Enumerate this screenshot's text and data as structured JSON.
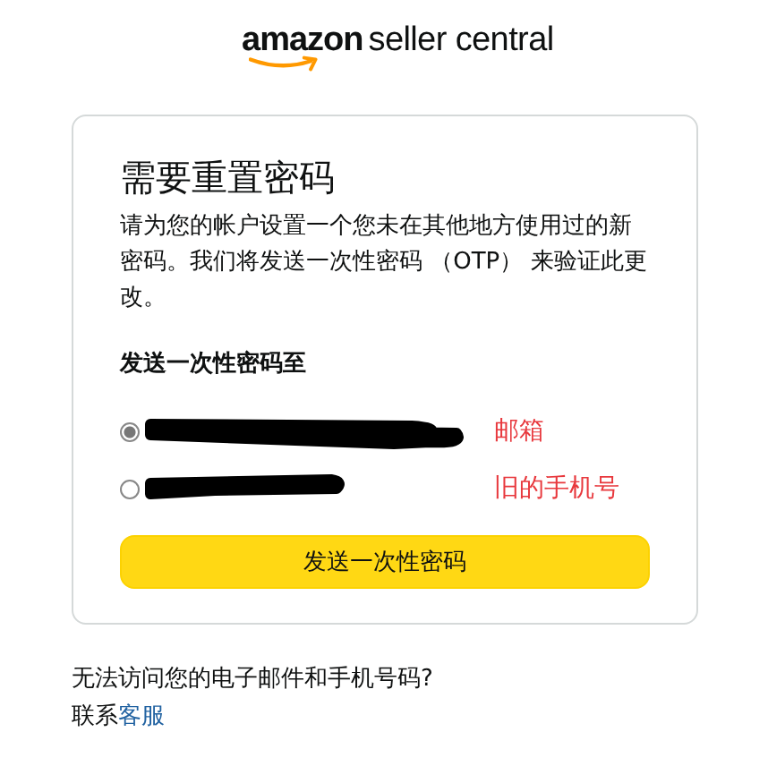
{
  "logo": {
    "brand": "amazon",
    "product": "seller central"
  },
  "card": {
    "title": "需要重置密码",
    "description": "请为您的帐户设置一个您未在其他地方使用过的新密码。我们将发送一次性密码 （OTP） 来验证此更改。",
    "options_label": "发送一次性密码至",
    "options": [
      {
        "selected": true,
        "annotation": "邮箱"
      },
      {
        "selected": false,
        "annotation": "旧的手机号"
      }
    ],
    "button": "发送一次性密码"
  },
  "footer": {
    "question": "无法访问您的电子邮件和手机号码?",
    "contact_prefix": "联系",
    "contact_link": "客服"
  }
}
